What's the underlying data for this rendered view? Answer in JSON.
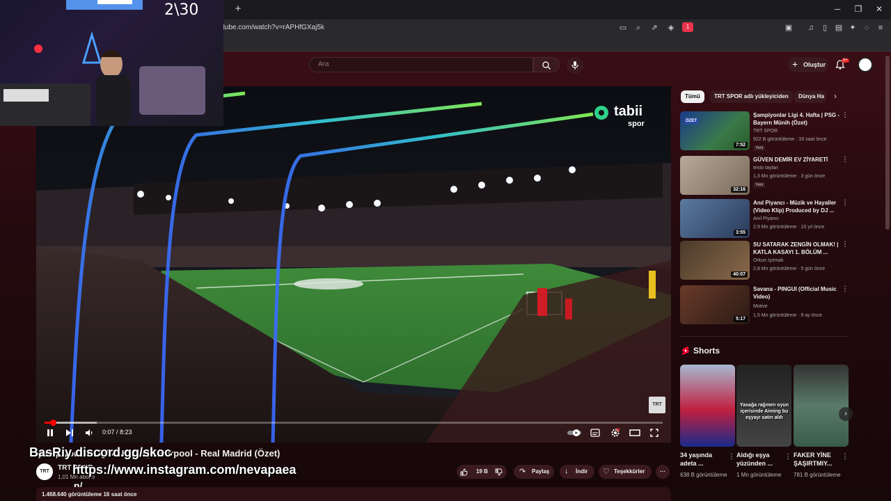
{
  "browser": {
    "url": "tube.com/watch?v=rAPHfGXaj5k",
    "new_tab": "+",
    "minimize": "─",
    "restore": "❐",
    "close": "✕",
    "shield_badge": "1"
  },
  "webcam": {
    "counter": "2\\30"
  },
  "masthead": {
    "search_placeholder": "Ara",
    "create_label": "Oluştur",
    "notification_count": "9+"
  },
  "player": {
    "watermark_brand": "tabii",
    "watermark_sub": "spor",
    "corner_mark": "TRT",
    "time": "0:07 / 8:23",
    "progress": 0.014,
    "buffered": 0.085
  },
  "video": {
    "title": "Şampiyonlar Ligi 4. Hafta | Liverpool - Real Madrid (Özet)",
    "channel_name": "TRT SPOR",
    "channel_subs": "1,01 Mn abone",
    "channel_avatar": "TRT",
    "likes": "19 B",
    "share_label": "Paylaş",
    "download_label": "İndir",
    "thanks_label": "Teşekkürler",
    "more_label": "···",
    "description": "1.468.640 görüntüleme  16 saat önce"
  },
  "overlays": {
    "discord": "BasRiy discord.gg/skoc",
    "instagram": "https://www.instagram.com/nevapaea",
    "tail": "n/"
  },
  "chips": [
    {
      "label": "Tümü",
      "active": true
    },
    {
      "label": "TRT SPOR adlı yükleyiciden",
      "active": false
    },
    {
      "label": "Dünya Ha",
      "active": false
    }
  ],
  "recommendations": [
    {
      "title": "Şampiyonlar Ligi 4. Hafta | PSG - Bayern Münih (Özet)",
      "channel": "TRT SPOR",
      "meta": "922 B görüntüleme · 16 saat önce",
      "badge": "Yeni",
      "duration": "7:52",
      "thumb_label": "ÖZET"
    },
    {
      "title": "GÜVEN DEMİR EV ZİYARETİ",
      "channel": "testo taylan",
      "meta": "1,3 Mn görüntüleme · 3 gün önce",
      "badge": "Yeni",
      "duration": "32:16"
    },
    {
      "title": "Anıl Piyancı - Müzik ve Hayaller (Video Klip) Produced by DJ ...",
      "channel": "Anıl Piyancı",
      "meta": "2,9 Mn görüntüleme · 10 yıl önce",
      "badge": "",
      "duration": "3:55"
    },
    {
      "title": "SU SATARAK ZENGİN OLMAK! | KATLA KASAYI 1. BÖLÜM ...",
      "channel": "Orkun Işıtmak",
      "meta": "2,8 Mn görüntüleme · 5 gün önce",
      "badge": "",
      "duration": "40:07"
    },
    {
      "title": "Savana - PINGUI (Official Music Video)",
      "channel": "Motive",
      "meta": "1,5 Mn görüntüleme · 9 ay önce",
      "badge": "",
      "duration": "5:17"
    }
  ],
  "shorts": {
    "heading": "Shorts",
    "items": [
      {
        "title": "34 yaşında adeta ...",
        "views": "638 B görüntüleme"
      },
      {
        "title": "Aldığı eşya yüzünden ...",
        "views": "1 Mn görüntüleme",
        "caption": "Yasağa rağmen oyun içerisinde Aiming bu eşyayı satın aldı"
      },
      {
        "title": "FAKER YİNE ŞAŞIRTMIY...",
        "views": "781 B görüntüleme"
      }
    ]
  },
  "colors": {
    "accent": "#ff0000",
    "page_bg": "#3a0e14",
    "chip_active": "#f1f1f1"
  }
}
